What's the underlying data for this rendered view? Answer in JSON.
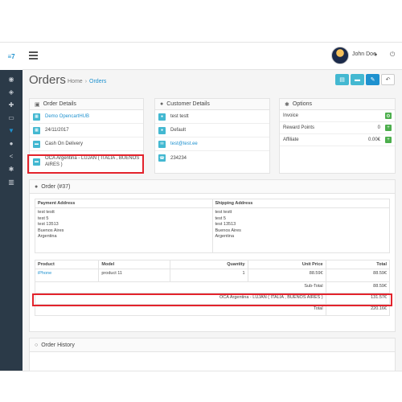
{
  "header": {
    "logo_text": "≡7",
    "username": "John Doe",
    "caret": "▾",
    "logout_icon": "⏻"
  },
  "sidebar": {
    "items": [
      {
        "icon": "dashboard-icon",
        "glyph": "◉",
        "active": false
      },
      {
        "icon": "tag-icon",
        "glyph": "◈",
        "active": false
      },
      {
        "icon": "puzzle-icon",
        "glyph": "✚",
        "active": false
      },
      {
        "icon": "monitor-icon",
        "glyph": "▭",
        "active": false
      },
      {
        "icon": "cart-icon",
        "glyph": "▼",
        "active": true
      },
      {
        "icon": "user-icon",
        "glyph": "●",
        "active": false
      },
      {
        "icon": "share-icon",
        "glyph": "<",
        "active": false
      },
      {
        "icon": "gear-icon",
        "glyph": "✱",
        "active": false
      },
      {
        "icon": "chart-icon",
        "glyph": "▥",
        "active": false
      }
    ]
  },
  "page": {
    "title": "Orders",
    "breadcrumb_home": "Home",
    "breadcrumb_sep": "›",
    "breadcrumb_current": "Orders"
  },
  "toolbar": {
    "print_invoice": "▤",
    "print_shipping": "▬",
    "edit": "✎",
    "back": "↶"
  },
  "order_details": {
    "heading": "Order Details",
    "store": "Demo OpencartHUB",
    "date": "24/11/2017",
    "payment": "Cash On Delivery",
    "shipping": "OCA Argentina - LUJAN ( ITALIA , BUENOS AIRES )"
  },
  "customer_details": {
    "heading": "Customer Details",
    "name": "test testt",
    "group": "Default",
    "email": "test@test.ee",
    "phone": "234234"
  },
  "options": {
    "heading": "Options",
    "rows": [
      {
        "label": "Invoice",
        "value": ""
      },
      {
        "label": "Reward Points",
        "value": "0"
      },
      {
        "label": "Affiliate",
        "value": "0.00€"
      }
    ]
  },
  "order": {
    "heading": "Order (#37)",
    "payment_address_label": "Payment Address",
    "shipping_address_label": "Shipping Address",
    "payment_address": [
      "test testt",
      "test 5",
      "test 13513",
      "Buenos Aires",
      "Argentina"
    ],
    "shipping_address": [
      "test testt",
      "test 5",
      "test 13513",
      "Buenos Aires",
      "Argentina"
    ],
    "columns": [
      "Product",
      "Model",
      "Quantity",
      "Unit Price",
      "Total"
    ],
    "items": [
      {
        "product": "iPhone",
        "model": "product 11",
        "quantity": "1",
        "unit_price": "88.59€",
        "total": "88.59€"
      }
    ],
    "totals": [
      {
        "label": "Sub-Total",
        "value": "88.59€"
      },
      {
        "label": "OCA Argentina - LUJAN ( ITALIA , BUENOS AIRES )",
        "value": "131.57€"
      },
      {
        "label": "Total",
        "value": "220.16€"
      }
    ]
  },
  "history": {
    "heading": "Order History"
  }
}
